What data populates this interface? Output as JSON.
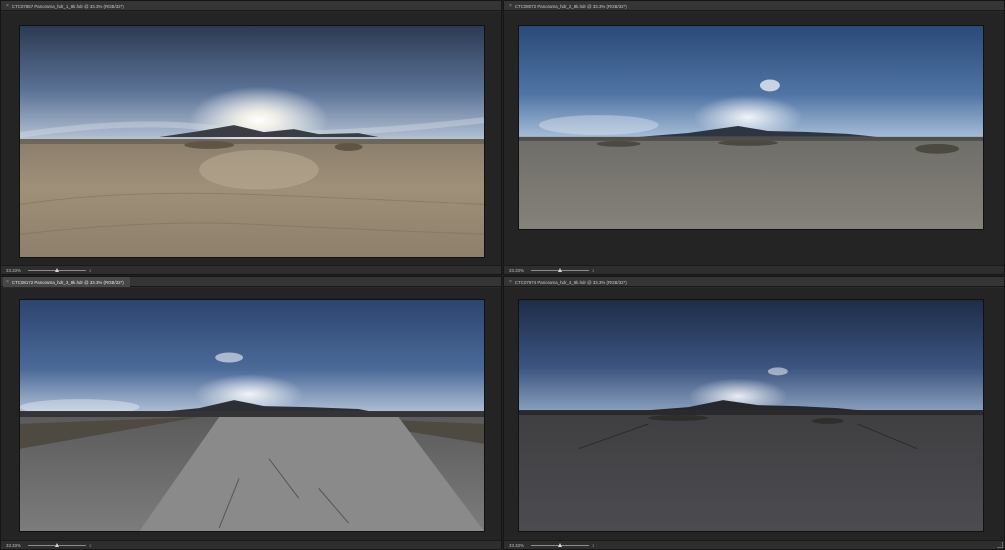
{
  "documents": [
    {
      "tab_title": "CTC07857 Panorama_hdr_1_8k.hdr @ 33.3% (RGB/32*)",
      "tab_active": false,
      "zoom_label": "33.33%",
      "zoom_fraction": 0.5,
      "slider_end": "3",
      "close_icon": "×",
      "image_alt": "Desert panorama with bright sun over mountains and sandy ground"
    },
    {
      "tab_title": "CTC08072 Panorama_hdr_2_8k.hdr @ 33.3% (RGB/32*)",
      "tab_active": false,
      "zoom_label": "33.33%",
      "zoom_fraction": 0.5,
      "slider_end": "3",
      "close_icon": "×",
      "image_alt": "Desert panorama with clouds over mountains and flat sand"
    },
    {
      "tab_title": "CTC08172 Panorama_hdr_3_8k.hdr @ 33.3% (RGB/32*)",
      "tab_active": true,
      "zoom_label": "33.33%",
      "zoom_fraction": 0.5,
      "slider_end": "3",
      "close_icon": "×",
      "image_alt": "Desert road panorama at dusk with shrubs"
    },
    {
      "tab_title": "CTC07974 Panorama_hdr_4_8k.hdr @ 33.3% (RGB/32*)",
      "tab_active": false,
      "zoom_label": "33.33%",
      "zoom_fraction": 0.5,
      "slider_end": "3",
      "close_icon": "×",
      "image_alt": "Dark desert panorama at dusk with low sun"
    }
  ]
}
